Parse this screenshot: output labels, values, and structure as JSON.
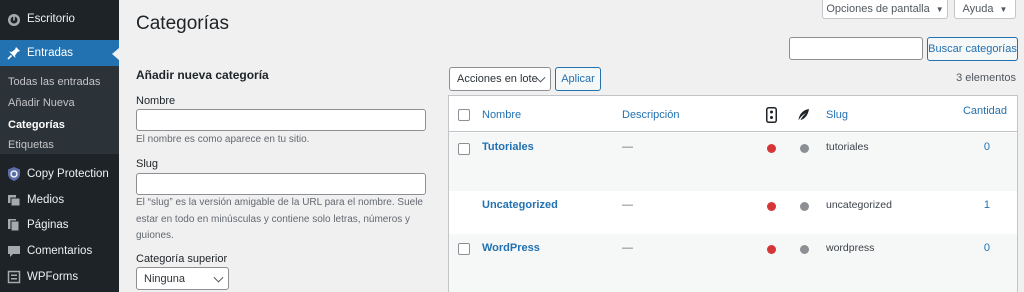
{
  "sidebar": {
    "items": [
      {
        "label": "Escritorio",
        "icon": "dashboard-icon"
      },
      {
        "label": "Entradas",
        "icon": "pin-icon"
      },
      {
        "label": "Copy Protection",
        "icon": "shield-icon"
      },
      {
        "label": "Medios",
        "icon": "media-icon"
      },
      {
        "label": "Páginas",
        "icon": "pages-icon"
      },
      {
        "label": "Comentarios",
        "icon": "comment-icon"
      },
      {
        "label": "WPForms",
        "icon": "forms-icon"
      }
    ],
    "submenu": [
      "Todas las entradas",
      "Añadir Nueva",
      "Categorías",
      "Etiquetas"
    ]
  },
  "header": {
    "title": "Categorías",
    "screen_options": "Opciones de pantalla",
    "help": "Ayuda",
    "search_button": "Buscar categorías"
  },
  "form": {
    "heading": "Añadir nueva categoría",
    "name_label": "Nombre",
    "name_help": "El nombre es como aparece en tu sitio.",
    "slug_label": "Slug",
    "slug_help": "El “slug” es la versión amigable de la URL para el nombre. Suele estar en todo en minúsculas y contiene solo letras, números y guiones.",
    "parent_label": "Categoría superior",
    "parent_value": "Ninguna"
  },
  "bulk": {
    "select_value": "Acciones en lote",
    "apply": "Aplicar",
    "count": "3 elementos"
  },
  "table": {
    "columns": {
      "name": "Nombre",
      "description": "Descripción",
      "slug": "Slug",
      "count": "Cantidad"
    },
    "rows": [
      {
        "name": "Tutoriales",
        "description": "—",
        "slug": "tutoriales",
        "count": "0"
      },
      {
        "name": "Uncategorized",
        "description": "—",
        "slug": "uncategorized",
        "count": "1"
      },
      {
        "name": "WordPress",
        "description": "—",
        "slug": "wordpress",
        "count": "0"
      }
    ]
  },
  "colors": {
    "sidebar_bg": "#1d2327",
    "accent": "#2271b1",
    "status_red": "#d63638",
    "status_grey": "#8c8f94"
  }
}
